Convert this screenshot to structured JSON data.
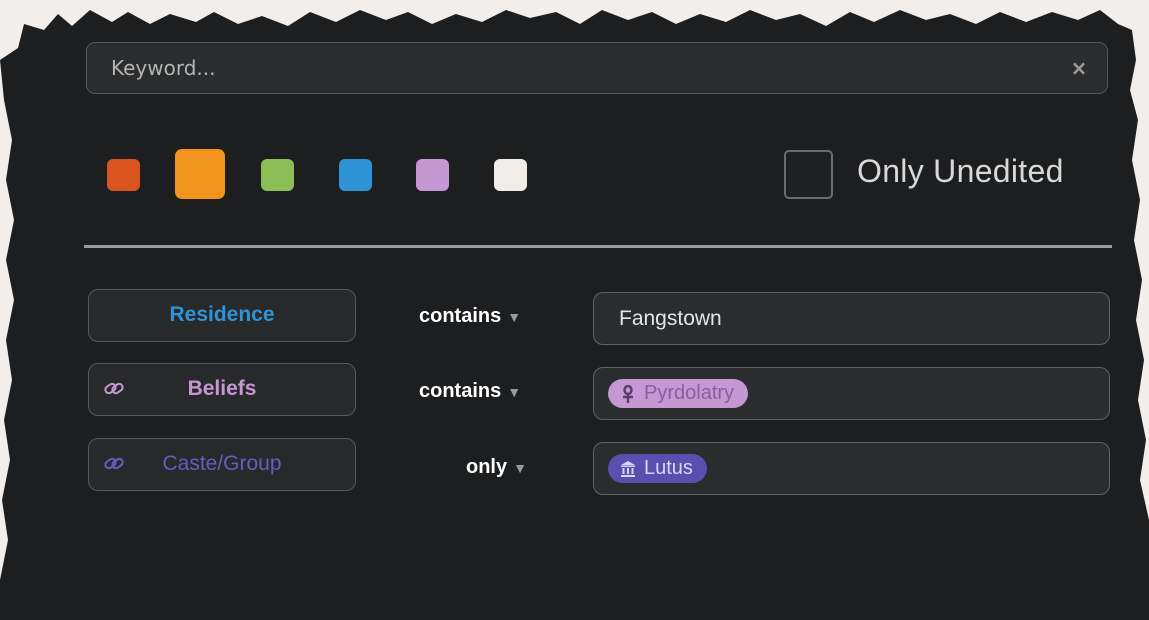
{
  "search": {
    "placeholder": "Keyword...",
    "value": "",
    "clear_icon": "close-icon"
  },
  "colors": [
    {
      "name": "red",
      "hex": "#d9541f",
      "selected": false
    },
    {
      "name": "orange",
      "hex": "#f0941f",
      "selected": true
    },
    {
      "name": "green",
      "hex": "#8bbd57",
      "selected": false
    },
    {
      "name": "blue",
      "hex": "#2f93d8",
      "selected": false
    },
    {
      "name": "purple",
      "hex": "#c597d3",
      "selected": false
    },
    {
      "name": "white",
      "hex": "#f1ede6",
      "selected": false
    }
  ],
  "only_unedited": {
    "label": "Only Unedited",
    "checked": false
  },
  "filters": [
    {
      "field": "Residence",
      "field_color": "#2f93d8",
      "linked": false,
      "operator": "contains",
      "value": "Fangstown"
    },
    {
      "field": "Beliefs",
      "field_color": "#c597d3",
      "linked": true,
      "operator": "contains",
      "tag": {
        "label": "Pyrdolatry",
        "icon": "ankh-icon",
        "color": "#c597d3"
      }
    },
    {
      "field": "Caste/Group",
      "field_color": "#6a5bbf",
      "linked": true,
      "operator": "only",
      "tag": {
        "label": "Lutus",
        "icon": "bank-icon",
        "color": "#5a4fb0"
      }
    }
  ],
  "theme": {
    "panel": "#1c1e20",
    "background": "#f2eeeb"
  }
}
